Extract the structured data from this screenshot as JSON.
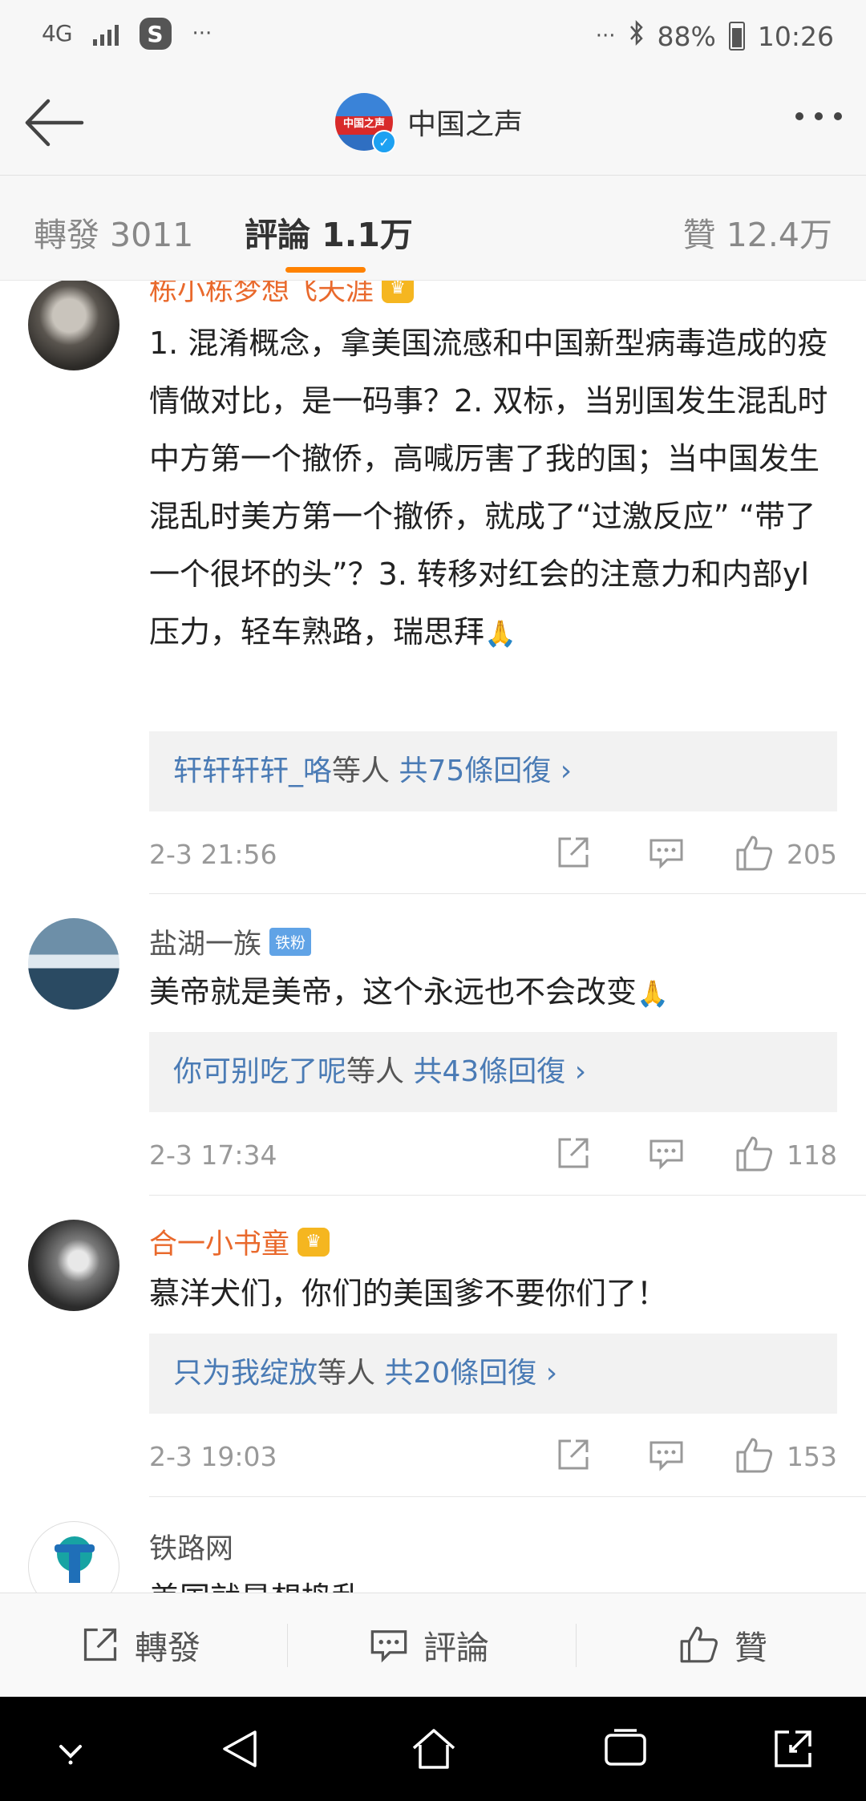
{
  "status_bar": {
    "network": "4G",
    "more": "···",
    "right_more": "···",
    "battery": "88%",
    "time": "10:26"
  },
  "header": {
    "avatar_text": "中国之声",
    "title": "中国之声"
  },
  "tabs": {
    "repost": "轉發 3011",
    "comment": "評論 1.1万",
    "like": "贊 12.4万"
  },
  "comments": [
    {
      "name": "栋小栋梦想飞天涯",
      "text": "1. 混淆概念，拿美国流感和中国新型病毒造成的疫情做对比，是一码事？2. 双标，当别国发生混乱时中方第一个撤侨，高喊厉害了我的国；当中国发生混乱时美方第一个撤侨，就成了“过激反应” “带了一个很坏的头”？3. 转移对红会的注意力和内部yl压力，轻车熟路，瑞思拜",
      "reply_names": "轩轩轩轩_咯",
      "reply_rest": "等人",
      "reply_count": "共75條回復 ›",
      "time": "2-3 21:56",
      "likes": "205"
    },
    {
      "name": "盐湖一族",
      "badge": "铁粉",
      "text": "美帝就是美帝，这个永远也不会改变",
      "reply_names": "你可别吃了呢",
      "reply_rest": "等人",
      "reply_count": "共43條回復 ›",
      "time": "2-3 17:34",
      "likes": "118"
    },
    {
      "name": "合一小书童",
      "text": "慕洋犬们，你们的美国爹不要你们了！",
      "reply_names": "只为我绽放",
      "reply_rest": "等人",
      "reply_count": "共20條回復 ›",
      "time": "2-3 19:03",
      "likes": "153"
    },
    {
      "name": "铁路网",
      "text": "美国就是想捣乱"
    }
  ],
  "bottom_bar": {
    "repost": "轉發",
    "comment": "評論",
    "like": "贊"
  }
}
